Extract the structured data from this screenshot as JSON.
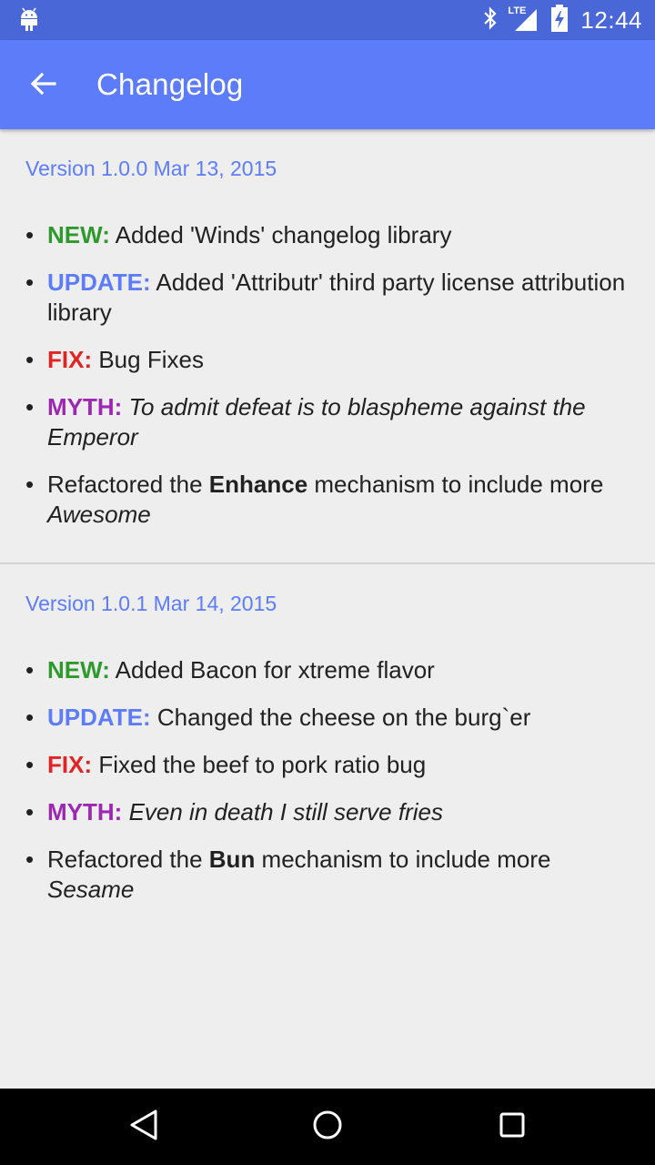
{
  "status_bar": {
    "time": "12:44",
    "icons": [
      "android-icon",
      "bluetooth-icon",
      "lte-signal-icon",
      "battery-charging-icon"
    ],
    "network_label": "LTE"
  },
  "app_bar": {
    "title": "Changelog",
    "back_icon": "arrow-left-icon"
  },
  "versions": [
    {
      "header": "Version 1.0.0 Mar 13, 2015",
      "changes": [
        {
          "type": "new",
          "tag": "NEW:",
          "text": "Added 'Winds' changelog library"
        },
        {
          "type": "update",
          "tag": "UPDATE:",
          "text": "Added 'Attributr' third party license attribution library"
        },
        {
          "type": "fix",
          "tag": "FIX:",
          "text": "Bug Fixes"
        },
        {
          "type": "myth",
          "tag": "MYTH:",
          "text": "To admit defeat is to blaspheme against the Emperor"
        },
        {
          "type": "plain",
          "before": "Refactored the ",
          "bold": "Enhance",
          "middle": " mechanism to include more ",
          "italic": "Awesome"
        }
      ]
    },
    {
      "header": "Version 1.0.1 Mar 14, 2015",
      "changes": [
        {
          "type": "new",
          "tag": "NEW:",
          "text": "Added Bacon for xtreme flavor"
        },
        {
          "type": "update",
          "tag": "UPDATE:",
          "text": "Changed the cheese on the burg`er"
        },
        {
          "type": "fix",
          "tag": "FIX:",
          "text": "Fixed the beef to pork ratio bug"
        },
        {
          "type": "myth",
          "tag": "MYTH:",
          "text": "Even in death I still serve fries"
        },
        {
          "type": "plain",
          "before": "Refactored the ",
          "bold": "Bun",
          "middle": " mechanism to include more ",
          "italic": "Sesame"
        }
      ]
    }
  ],
  "nav_bar": {
    "buttons": [
      "back-triangle-icon",
      "home-circle-icon",
      "recents-square-icon"
    ]
  },
  "colors": {
    "status_bar": "#4a67d8",
    "app_bar": "#5c7cfa",
    "new": "#2e9a2e",
    "update": "#5c7cfa",
    "fix": "#e02424",
    "myth": "#9c27b0"
  }
}
